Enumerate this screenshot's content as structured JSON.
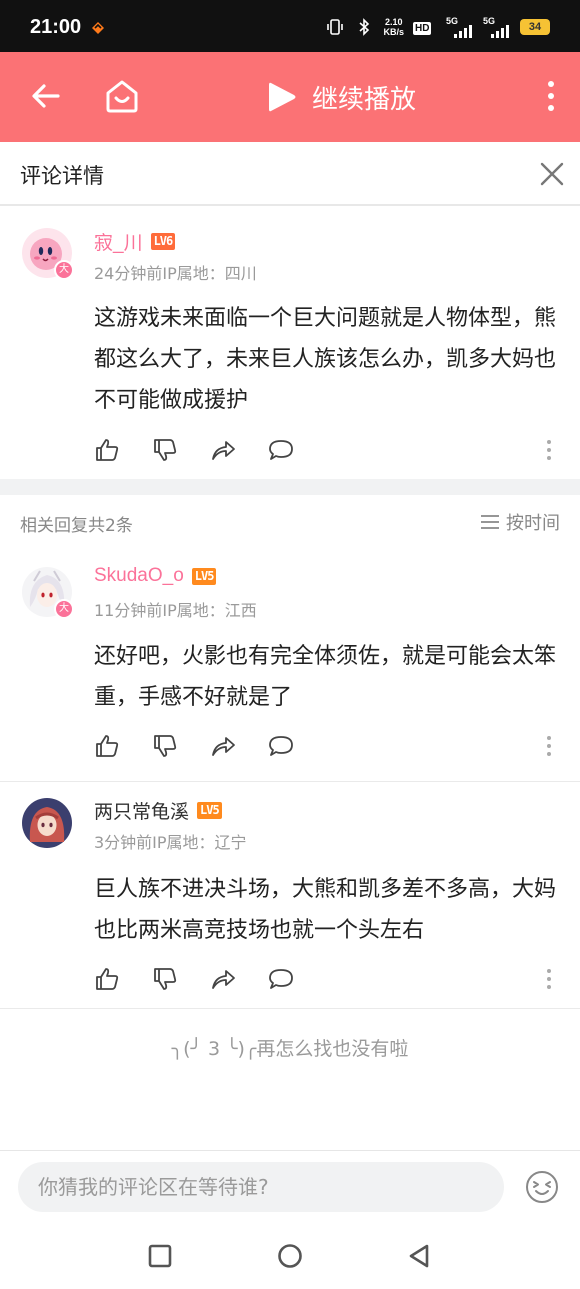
{
  "status_bar": {
    "time": "21:00",
    "net_speed_value": "2.10",
    "net_speed_unit": "KB/s",
    "hd_label": "HD",
    "sim1_label": "5G",
    "sim2_label": "5G",
    "battery": "34"
  },
  "toolbar": {
    "continue_play_label": "继续播放"
  },
  "detail_header": {
    "title": "评论详情"
  },
  "main_comment": {
    "username": "寂_川",
    "level": "LV6",
    "meta": "24分钟前IP属地：四川",
    "text": "这游戏未来面临一个巨大问题就是人物体型，熊都这么大了，未来巨人族该怎么办，凯多大妈也不可能做成援护",
    "avatar_badge": "大"
  },
  "replies_header": {
    "count_label": "相关回复共2条",
    "sort_label": "按时间"
  },
  "replies": [
    {
      "username": "SkudaO_o",
      "level": "LV5",
      "meta": "11分钟前IP属地：江西",
      "text": "还好吧，火影也有完全体须佐，就是可能会太笨重，手感不好就是了",
      "avatar_badge": "大"
    },
    {
      "username": "两只常龟溪",
      "level": "LV5",
      "meta": "3分钟前IP属地：辽宁",
      "text": "巨人族不进决斗场，大熊和凯多差不多高，大妈也比两米高竞技场也就一个头左右"
    }
  ],
  "end_text": "╮(╯ 3 ╰)╭再怎么找也没有啦",
  "input": {
    "placeholder": "你猜我的评论区在等待谁?"
  },
  "colors": {
    "brand_pink": "#fb7275",
    "username_pink": "#fb7299",
    "level6": "#ff6b3a",
    "level5": "#ff8a1e"
  },
  "icons": [
    "back-arrow-icon",
    "home-icon",
    "play-icon",
    "more-vertical-icon",
    "close-icon",
    "like-icon",
    "dislike-icon",
    "share-icon",
    "reply-icon",
    "sort-icon",
    "emoji-icon",
    "nav-recents-icon",
    "nav-home-icon",
    "nav-back-icon"
  ]
}
